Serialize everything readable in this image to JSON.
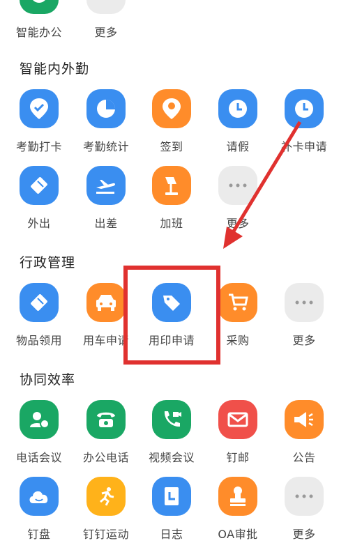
{
  "top_row": [
    {
      "label": "智能办公",
      "icon": "smart-office-icon"
    },
    {
      "label": "更多",
      "icon": "more-icon"
    }
  ],
  "sections": [
    {
      "title": "智能内外勤",
      "rows": [
        [
          {
            "label": "考勤打卡",
            "icon": "location-check-icon",
            "color": "#3a8ef0"
          },
          {
            "label": "考勤统计",
            "icon": "pie-chart-icon",
            "color": "#3a8ef0"
          },
          {
            "label": "签到",
            "icon": "location-pin-icon",
            "color": "#ff8c2a"
          },
          {
            "label": "请假",
            "icon": "clock-icon",
            "color": "#3a8ef0"
          },
          {
            "label": "补卡申请",
            "icon": "clock-icon",
            "color": "#3a8ef0"
          }
        ],
        [
          {
            "label": "外出",
            "icon": "walk-icon",
            "color": "#3a8ef0"
          },
          {
            "label": "出差",
            "icon": "airplane-icon",
            "color": "#3a8ef0"
          },
          {
            "label": "加班",
            "icon": "desk-lamp-icon",
            "color": "#ff8c2a"
          },
          {
            "label": "更多",
            "icon": "more-icon",
            "color": "#ebebeb"
          }
        ]
      ]
    },
    {
      "title": "行政管理",
      "rows": [
        [
          {
            "label": "物品领用",
            "icon": "item-icon",
            "color": "#3a8ef0"
          },
          {
            "label": "用车申请",
            "icon": "car-icon",
            "color": "#ff8c2a"
          },
          {
            "label": "用印申请",
            "icon": "tag-icon",
            "color": "#3a8ef0"
          },
          {
            "label": "采购",
            "icon": "cart-icon",
            "color": "#ff8c2a"
          },
          {
            "label": "更多",
            "icon": "more-icon",
            "color": "#ebebeb"
          }
        ]
      ]
    },
    {
      "title": "协同效率",
      "rows": [
        [
          {
            "label": "电话会议",
            "icon": "conference-call-icon",
            "color": "#1aa764"
          },
          {
            "label": "办公电话",
            "icon": "phone-icon",
            "color": "#1aa764"
          },
          {
            "label": "视频会议",
            "icon": "video-call-icon",
            "color": "#1aa764"
          },
          {
            "label": "钉邮",
            "icon": "mail-icon",
            "color": "#f0504a"
          },
          {
            "label": "公告",
            "icon": "megaphone-icon",
            "color": "#ff8c2a"
          }
        ],
        [
          {
            "label": "钉盘",
            "icon": "cloud-drive-icon",
            "color": "#3a8ef0"
          },
          {
            "label": "钉钉运动",
            "icon": "running-icon",
            "color": "#ffb21a"
          },
          {
            "label": "日志",
            "icon": "journal-icon",
            "color": "#3a8ef0"
          },
          {
            "label": "OA审批",
            "icon": "stamp-icon",
            "color": "#ff8c2a"
          },
          {
            "label": "更多",
            "icon": "more-icon",
            "color": "#ebebeb"
          }
        ]
      ]
    }
  ],
  "annotation": {
    "highlight_color": "#e0312f",
    "arrow_color": "#e0312f"
  }
}
